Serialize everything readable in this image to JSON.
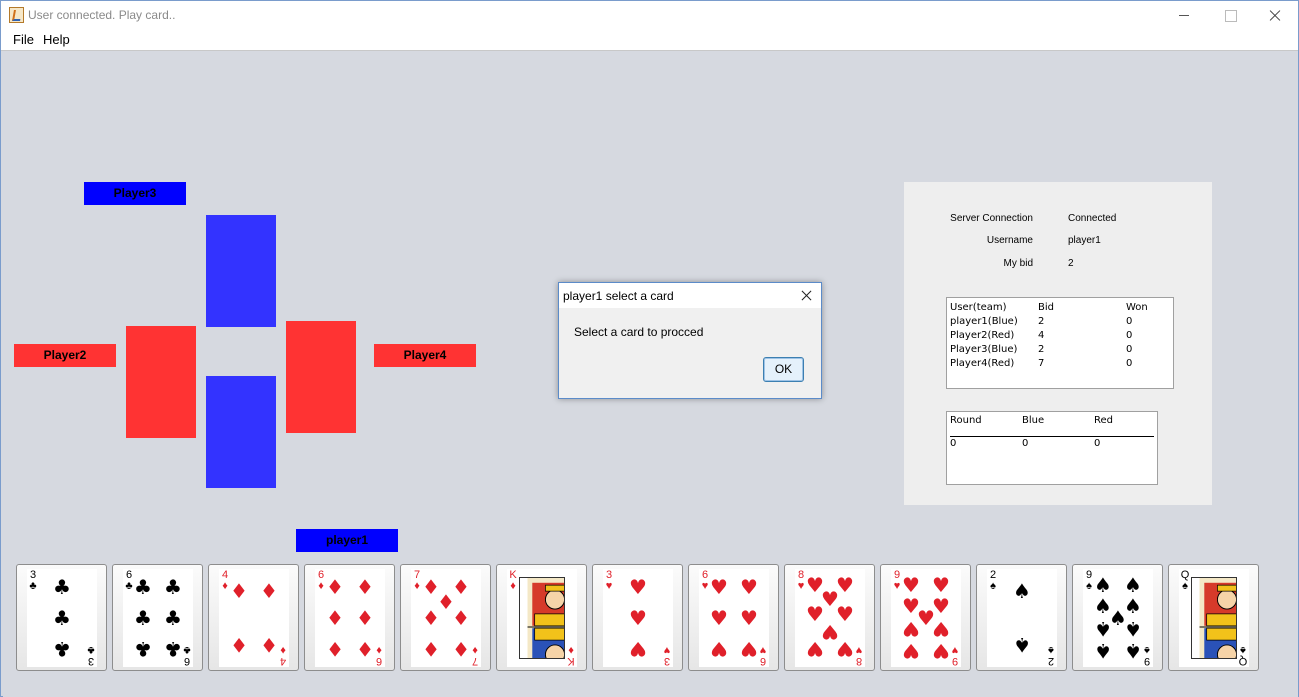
{
  "window": {
    "title": "User connected. Play card.."
  },
  "menu": {
    "file": "File",
    "help": "Help"
  },
  "players": {
    "top": {
      "name": "Player3",
      "team_color": "#0000ff"
    },
    "left": {
      "name": "Player2",
      "team_color": "#ff3333"
    },
    "right": {
      "name": "Player4",
      "team_color": "#ff3333"
    },
    "bottom": {
      "name": "player1",
      "team_color": "#0000ff"
    }
  },
  "info": {
    "server_connection_label": "Server Connection",
    "server_connection_value": "Connected",
    "username_label": "Username",
    "username_value": "player1",
    "bid_label": "My bid",
    "bid_value": "2"
  },
  "bid_table": {
    "headers": [
      "User(team)",
      "Bid",
      "Won"
    ],
    "rows": [
      [
        "player1(Blue)",
        "2",
        "0"
      ],
      [
        "Player2(Red)",
        "4",
        "0"
      ],
      [
        "Player3(Blue)",
        "2",
        "0"
      ],
      [
        "Player4(Red)",
        "7",
        "0"
      ]
    ]
  },
  "score_table": {
    "headers": [
      "Round",
      "Blue",
      "Red"
    ],
    "rows": [
      [
        "0",
        "0",
        "0"
      ]
    ]
  },
  "dialog": {
    "title": "player1 select a card",
    "message": "Select a card to procced",
    "ok_label": "OK"
  },
  "hand": [
    {
      "rank": "3",
      "suit": "♣",
      "color": "black"
    },
    {
      "rank": "6",
      "suit": "♣",
      "color": "black"
    },
    {
      "rank": "4",
      "suit": "♦",
      "color": "red"
    },
    {
      "rank": "6",
      "suit": "♦",
      "color": "red"
    },
    {
      "rank": "7",
      "suit": "♦",
      "color": "red"
    },
    {
      "rank": "K",
      "suit": "♦",
      "color": "red"
    },
    {
      "rank": "3",
      "suit": "♥",
      "color": "red"
    },
    {
      "rank": "6",
      "suit": "♥",
      "color": "red"
    },
    {
      "rank": "8",
      "suit": "♥",
      "color": "red"
    },
    {
      "rank": "9",
      "suit": "♥",
      "color": "red"
    },
    {
      "rank": "2",
      "suit": "♠",
      "color": "black"
    },
    {
      "rank": "9",
      "suit": "♠",
      "color": "black"
    },
    {
      "rank": "Q",
      "suit": "♠",
      "color": "black"
    }
  ],
  "colors": {
    "blue_slot": "#3333ff",
    "red_slot": "#ff3333",
    "panel_bg": "#eeeeee",
    "content_bg": "#d6d9e0"
  }
}
